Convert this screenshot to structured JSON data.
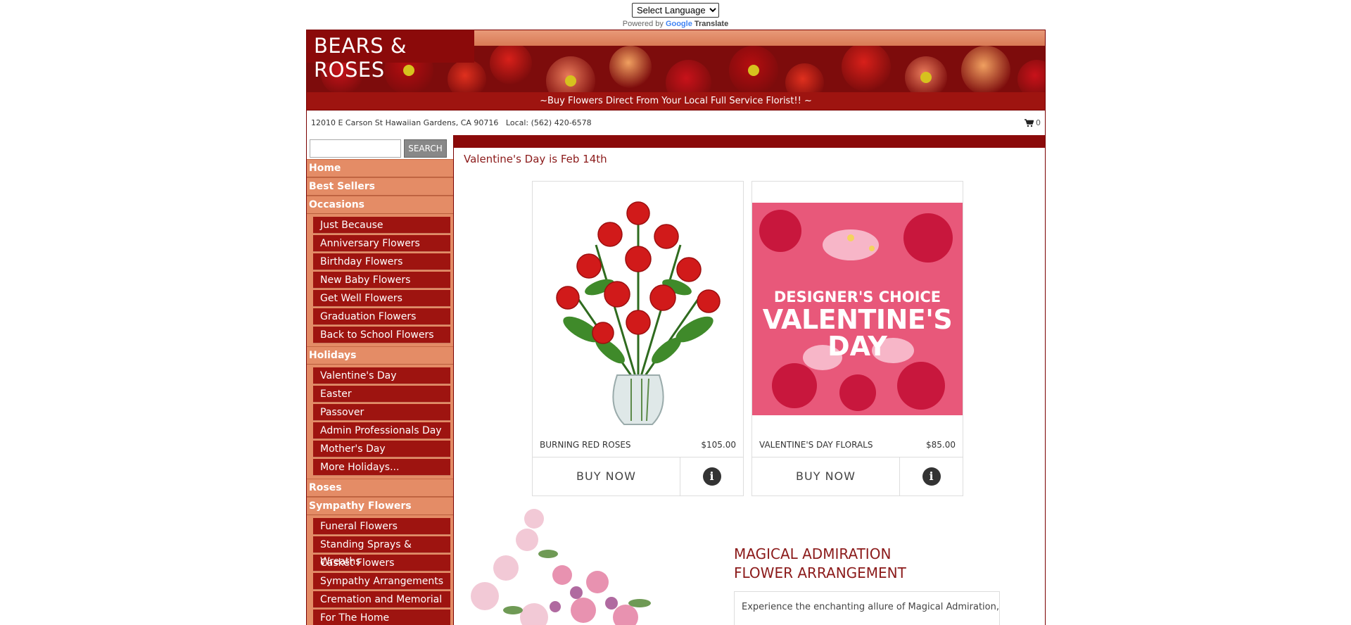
{
  "translate": {
    "select_label": "Select Language",
    "powered_by": "Powered by",
    "google": "Google",
    "translate": "Translate"
  },
  "header": {
    "brand": "BEARS & ROSES",
    "tagline": "~Buy Flowers Direct From Your Local Full Service Florist!! ~",
    "address": "12010 E Carson St Hawaiian Gardens, CA 90716",
    "phone": "Local: (562) 420-6578",
    "cart_count": "0"
  },
  "search": {
    "placeholder": "",
    "button": "SEARCH"
  },
  "sidebar": {
    "home": "Home",
    "best_sellers": "Best Sellers",
    "occasions": "Occasions",
    "occasion_items": [
      "Just Because",
      "Anniversary Flowers",
      "Birthday Flowers",
      "New Baby Flowers",
      "Get Well Flowers",
      "Graduation Flowers",
      "Back to School Flowers"
    ],
    "holidays": "Holidays",
    "holiday_items": [
      "Valentine's Day",
      "Easter",
      "Passover",
      "Admin Professionals Day",
      "Mother's Day",
      "More Holidays..."
    ],
    "roses": "Roses",
    "sympathy": "Sympathy Flowers",
    "sympathy_items": [
      "Funeral Flowers",
      "Standing Sprays & Wreaths",
      "Casket Flowers",
      "Sympathy Arrangements",
      "Cremation and Memorial",
      "For The Home"
    ]
  },
  "main": {
    "notice": "Valentine's Day is Feb 14th",
    "products": [
      {
        "name": "BURNING RED ROSES",
        "price": "$105.00",
        "buy": "BUY NOW",
        "info": "i"
      },
      {
        "name": "VALENTINE'S DAY FLORALS",
        "price": "$85.00",
        "buy": "BUY NOW",
        "info": "i",
        "overlay_1": "DESIGNER'S CHOICE",
        "overlay_2": "VALENTINE'S",
        "overlay_3": "DAY"
      }
    ],
    "feature": {
      "title_line1": "MAGICAL ADMIRATION",
      "title_line2": "FLOWER ARRANGEMENT",
      "description": "Experience the enchanting allure of Magical Admiration, a"
    }
  },
  "colors": {
    "brand_red": "#8b0a0a",
    "menu_salmon": "#e48c66",
    "submenu_red": "#9e1410"
  }
}
